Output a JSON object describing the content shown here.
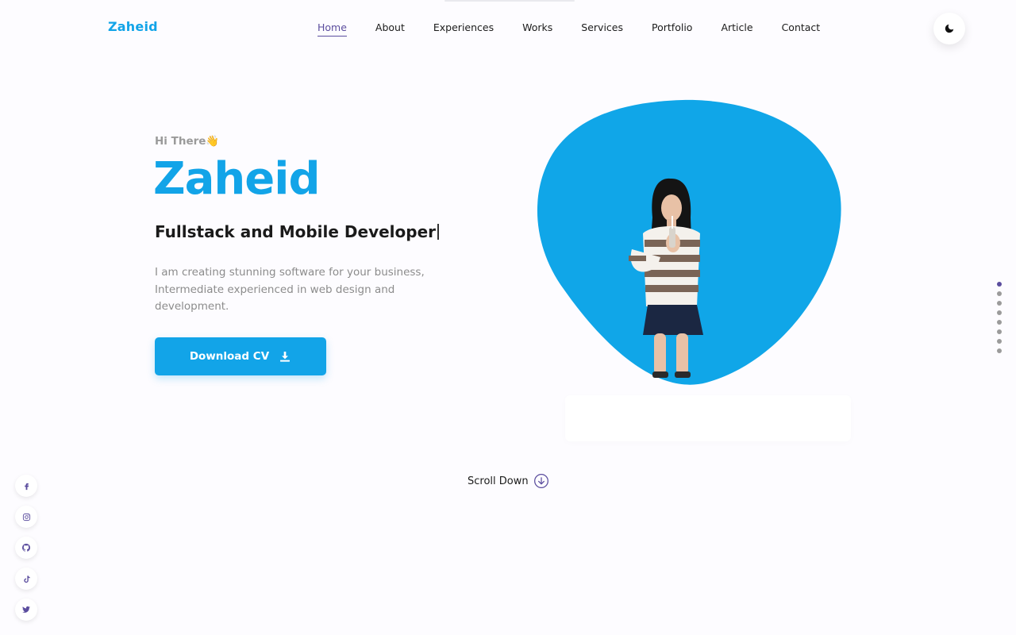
{
  "header": {
    "logo": "Zaheid",
    "nav": [
      {
        "label": "Home",
        "active": true
      },
      {
        "label": "About"
      },
      {
        "label": "Experiences"
      },
      {
        "label": "Works"
      },
      {
        "label": "Services"
      },
      {
        "label": "Portfolio"
      },
      {
        "label": "Article"
      },
      {
        "label": "Contact"
      }
    ],
    "theme_toggle_icon": "moon-icon"
  },
  "hero": {
    "greeting": "Hi There",
    "greeting_emoji": "👋",
    "name": "Zaheid",
    "role": "Fullstack and Mobile Developer",
    "bio": "I am creating stunning software for your business, Intermediate experienced in web design and development.",
    "cta": {
      "label": "Download CV",
      "icon": "download-icon"
    }
  },
  "scroll": {
    "label": "Scroll Down",
    "icon": "arrow-down-circle-icon"
  },
  "section_dots": {
    "count": 8,
    "active_index": 0
  },
  "socials": [
    {
      "name": "facebook-icon"
    },
    {
      "name": "instagram-icon"
    },
    {
      "name": "github-icon"
    },
    {
      "name": "tiktok-icon"
    },
    {
      "name": "twitter-icon"
    }
  ],
  "colors": {
    "accent": "#12a4e8",
    "nav_active": "#5b4d9e",
    "background": "#fdfcff"
  }
}
